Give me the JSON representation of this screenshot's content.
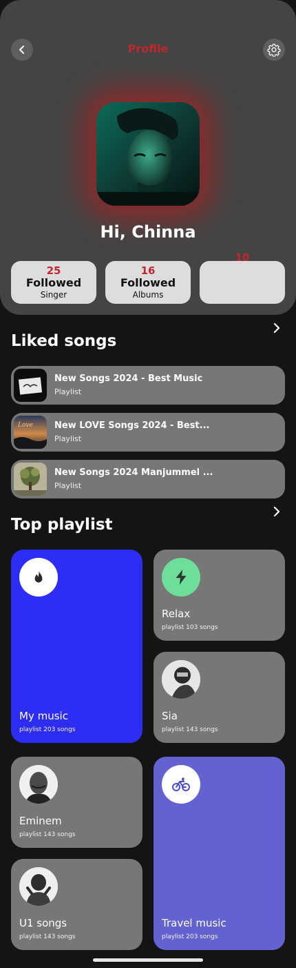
{
  "header": {
    "title": "Profile",
    "greeting": "Hi, Chinna",
    "back_icon": "chevron-left-icon",
    "settings_icon": "gear-icon",
    "accent_color": "#c0272d"
  },
  "stats": [
    {
      "count": "25",
      "label": "Followed",
      "sub": "Singer"
    },
    {
      "count": "16",
      "label": "Followed",
      "sub": "Albums"
    },
    {
      "count": "10",
      "label": "",
      "sub": ""
    }
  ],
  "liked": {
    "title": "Liked songs",
    "items": [
      {
        "title": "New Songs 2024 - Best Music",
        "sub": "Playlist"
      },
      {
        "title": "New LOVE Songs 2024 - Best...",
        "sub": "Playlist"
      },
      {
        "title": "New Songs 2024 Manjummel ...",
        "sub": "Playlist"
      }
    ]
  },
  "top": {
    "title": "Top playlist",
    "tiles": [
      {
        "name": "My music",
        "sub": "playlist 203 songs",
        "color": "#2d2df5"
      },
      {
        "name": "Relax",
        "sub": "playlist 103 songs",
        "color": "#777777"
      },
      {
        "name": "Sia",
        "sub": "playlist 143 songs",
        "color": "#777777"
      },
      {
        "name": "Eminem",
        "sub": "playlist 143 songs",
        "color": "#777777"
      },
      {
        "name": "U1 songs",
        "sub": "playlist 143 songs",
        "color": "#777777"
      },
      {
        "name": "Travel music",
        "sub": "playlist 203 songs",
        "color": "#6262d0"
      }
    ]
  }
}
